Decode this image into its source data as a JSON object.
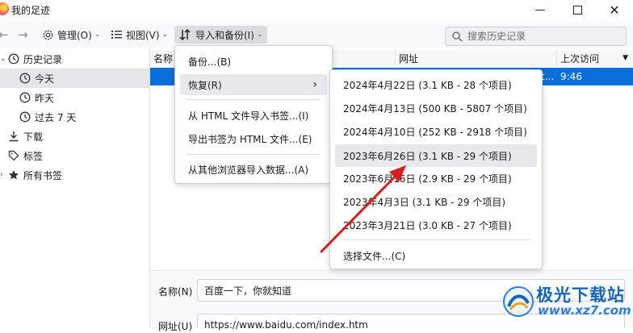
{
  "window": {
    "title": "我的足迹"
  },
  "toolbar": {
    "manage": "管理(O)",
    "view": "视图(V)",
    "import_backup": "导入和备份(I)",
    "search_placeholder": "搜索历史记录"
  },
  "sidebar": {
    "items": [
      {
        "label": "历史记录"
      },
      {
        "label": "今天"
      },
      {
        "label": "昨天"
      },
      {
        "label": "过去 7 天"
      },
      {
        "label": "下载"
      },
      {
        "label": "标签"
      },
      {
        "label": "所有书签"
      }
    ]
  },
  "table": {
    "columns": [
      "名称",
      "网址",
      "上次访问"
    ],
    "selected_row": {
      "url_tail": "t...",
      "time": "9:46"
    }
  },
  "detail": {
    "name_label": "名称(N)",
    "name_value": "百度一下，你就知道",
    "url_label": "网址(U)",
    "url_value": "https://www.baidu.com/index.htm"
  },
  "import_menu": {
    "items": [
      "备份...(B)",
      "恢复(R)",
      "从 HTML 文件导入书签...(I)",
      "导出书签为 HTML 文件...(E)",
      "从其他浏览器导入数据...(A)"
    ]
  },
  "restore_menu": {
    "items": [
      "2024年4月22日 (3.1 KB - 28 个项目)",
      "2024年4月13日 (500 KB - 5807 个项目)",
      "2024年4月10日 (252 KB - 2918 个项目)",
      "2023年6月26日 (3.1 KB - 29 个项目)",
      "2023年6月16日 (2.9 KB - 29 个项目)",
      "2023年4月3日 (3.1 KB - 29 个项目)",
      "2023年3月21日 (3.0 KB - 27 个项目)"
    ],
    "choose_file": "选择文件...(C)"
  },
  "watermark": {
    "cn": "极光下载站",
    "en": "www.xz7.com"
  },
  "colors": {
    "selection": "#0a6fdb",
    "arrow": "#d81e1e",
    "watermark": "#1565c0"
  }
}
